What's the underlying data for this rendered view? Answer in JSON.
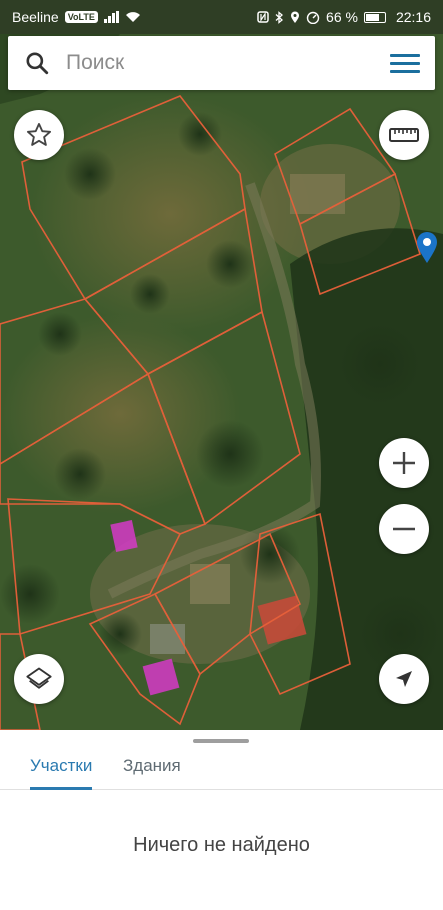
{
  "status_bar": {
    "carrier": "Beeline",
    "network_badge": "VoLTE",
    "battery": "66 %",
    "time": "22:16"
  },
  "search": {
    "placeholder": "Поиск"
  },
  "map": {
    "icons": {
      "favorites": "star-icon",
      "ruler": "ruler-icon",
      "zoom_in": "plus-icon",
      "zoom_out": "minus-icon",
      "layers": "layers-icon",
      "my_location": "navigation-arrow-icon",
      "marker": "location-pin-icon"
    },
    "colors": {
      "parcel_outline": "#e8603a",
      "building_marker": "#d63ac8",
      "pin": "#1b74c8"
    }
  },
  "sheet": {
    "tabs": [
      {
        "label": "Участки",
        "active": true
      },
      {
        "label": "Здания",
        "active": false
      }
    ],
    "empty_message": "Ничего не найдено"
  },
  "colors": {
    "accent": "#2a7ab0",
    "menu": "#1b6f9e"
  }
}
